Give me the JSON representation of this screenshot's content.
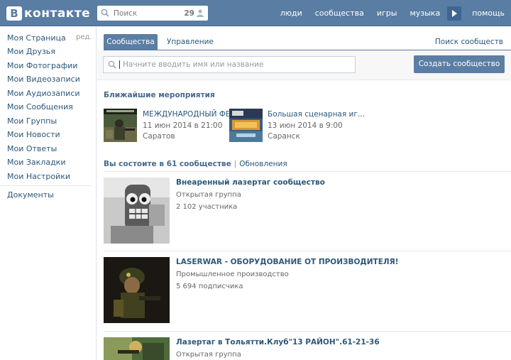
{
  "header": {
    "logo_letter": "В",
    "logo_text": "контакте",
    "search_placeholder": "Поиск",
    "online_count": "29",
    "nav": [
      "люди",
      "сообщества",
      "игры",
      "музыка",
      "помощь"
    ]
  },
  "sidebar": {
    "items": [
      "Моя Страница",
      "Мои Друзья",
      "Мои Фотографии",
      "Мои Видеозаписи",
      "Мои Аудиозаписи",
      "Мои Сообщения",
      "Мои Группы",
      "Мои Новости",
      "Мои Ответы",
      "Мои Закладки",
      "Мои Настройки"
    ],
    "edit_label": "ред.",
    "extra": "Документы"
  },
  "tabs": {
    "active": "Сообщества",
    "other": "Управление",
    "find_link": "Поиск сообществ"
  },
  "community_search": {
    "placeholder": "Начните вводить имя или название",
    "create_button": "Создать сообщество"
  },
  "events": {
    "title": "Ближайшие мероприятия",
    "items": [
      {
        "name": "МЕЖДУНАРОДНЫЙ ФЕ...",
        "date": "11 июн 2014 в 21:00",
        "city": "Саратов"
      },
      {
        "name": "Большая сценарная иг...",
        "date": "13 июн 2014 в 9:00",
        "city": "Саранск"
      }
    ]
  },
  "membership": {
    "title": "Вы состоите в 61 сообществе",
    "separator": "|",
    "updates": "Обновления"
  },
  "groups": [
    {
      "name": "Внеаренный лазертаг сообщество",
      "type": "Открытая группа",
      "count": "2 102 участника"
    },
    {
      "name": "LASERWAR - ОБОРУДОВАНИЕ ОТ ПРОИЗВОДИТЕЛЯ!",
      "type": "Промышленное производство",
      "count": "5 694 подписчика"
    },
    {
      "name": "Лазертаг в Тольятти.Клуб\"13 РАЙОН\".61-21-36",
      "type": "Открытая группа",
      "count": ""
    }
  ],
  "colors": {
    "header_bg": "#597da3",
    "link": "#2b587a",
    "accent": "#5b7ea4"
  }
}
